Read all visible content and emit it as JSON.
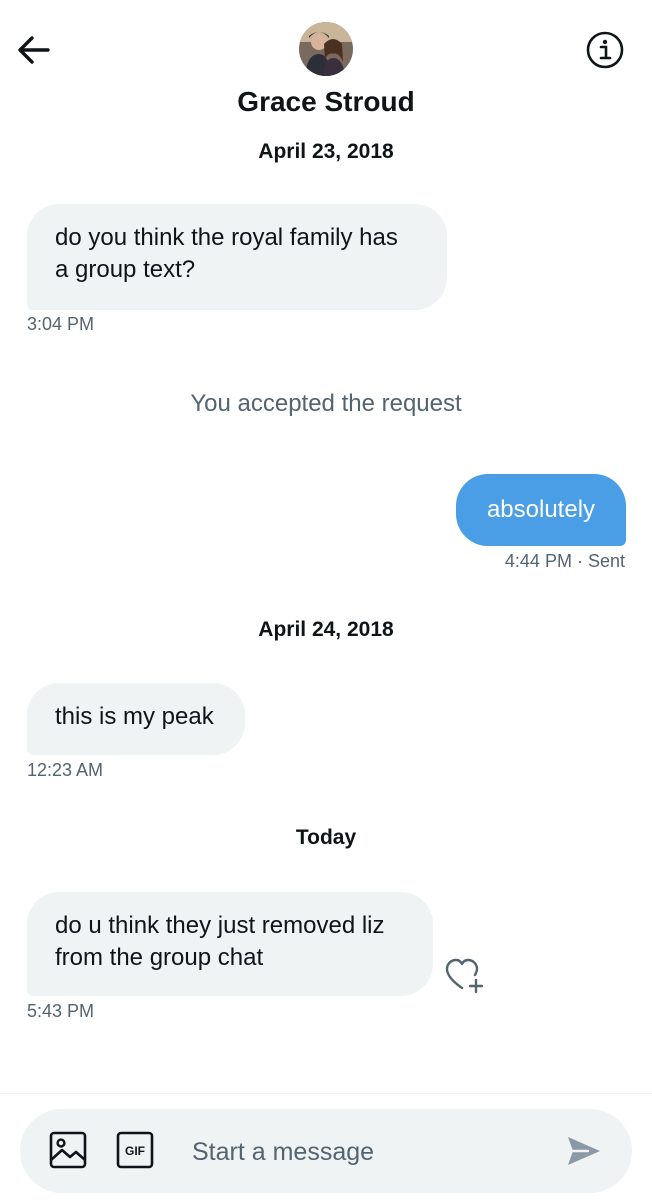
{
  "header": {
    "contact_name": "Grace Stroud"
  },
  "conversation": {
    "date_1": "April 23, 2018",
    "msg_1": {
      "line_1": "do you think the royal family has",
      "line_2": "a group text?",
      "time": "3:04 PM"
    },
    "system_message": "You accepted the request",
    "msg_2": {
      "text": "absolutely",
      "time": "4:44 PM",
      "status": "· Sent"
    },
    "date_2": "April 24, 2018",
    "msg_3": {
      "text": "this is my peak",
      "time": "12:23 AM"
    },
    "date_3": "Today",
    "msg_4": {
      "line_1": "do u think they just removed liz",
      "line_2": "from the group chat",
      "time": "5:43 PM"
    }
  },
  "composer": {
    "placeholder": "Start a message",
    "gif_label": "GIF"
  },
  "colors": {
    "accent": "#1d9bf0",
    "outgoing_bubble": "#4a9ee6",
    "incoming_bubble": "#eff3f4",
    "secondary_text": "#536471"
  },
  "icons": [
    "back-arrow-icon",
    "info-icon",
    "heart-plus-icon",
    "image-icon",
    "gif-icon",
    "send-icon"
  ]
}
